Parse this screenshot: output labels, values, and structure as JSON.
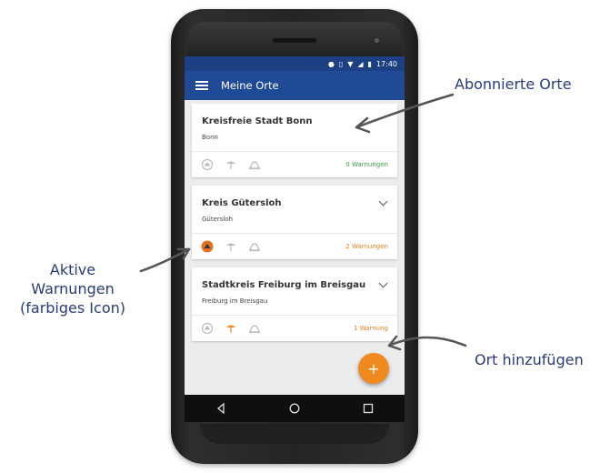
{
  "status": {
    "time": "17:40"
  },
  "appbar": {
    "title": "Meine Orte"
  },
  "cards": [
    {
      "title": "Kreisfreie Stadt Bonn",
      "subtitle": "Bonn",
      "warnings": "0 Warnungen",
      "warn_color": "#3a9a48",
      "active_icon": "none"
    },
    {
      "title": "Kreis Gütersloh",
      "subtitle": "Gütersloh",
      "warnings": "2 Warnungen",
      "warn_color": "#e57f1e",
      "active_icon": "weather"
    },
    {
      "title": "Stadtkreis Freiburg im Breisgau",
      "subtitle": "Freiburg im Breisgau",
      "warnings": "1 Warnung",
      "warn_color": "#e57f1e",
      "active_icon": "flood"
    }
  ],
  "fab": {
    "label": "+"
  },
  "annotations": {
    "subscribed": "Abonnierte Orte",
    "active_line1": "Aktive",
    "active_line2": "Warnungen",
    "active_line3": "(farbiges Icon)",
    "add": "Ort hinzufügen"
  },
  "colors": {
    "statusbar": "#1d3f83",
    "appbar": "#204a95",
    "accent": "#f08a1e",
    "annotation": "#2a3a7a"
  }
}
